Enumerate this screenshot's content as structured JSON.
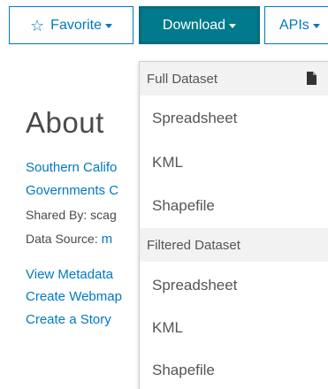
{
  "toolbar": {
    "favorite_label": "Favorite",
    "download_label": "Download",
    "apis_label": "APIs"
  },
  "about": {
    "title": "About",
    "org_line1": "Southern Califo",
    "org_line2": "Governments C",
    "shared_by": "Shared By: scag",
    "data_source_prefix": "Data Source: ",
    "data_source_link": "m",
    "links": [
      "View Metadata",
      "Create Webmap",
      "Create a Story"
    ]
  },
  "download_menu": {
    "full_header": "Full Dataset",
    "full_items": [
      "Spreadsheet",
      "KML",
      "Shapefile"
    ],
    "filtered_header": "Filtered Dataset",
    "filtered_items": [
      "Spreadsheet",
      "KML",
      "Shapefile"
    ]
  },
  "icons": {
    "favorite": "star-outline-icon",
    "caret": "caret-down-icon",
    "file": "file-icon"
  },
  "colors": {
    "link": "#0079c1",
    "download_button": "#007a8c",
    "menu_header_bg": "#f2f2f2"
  }
}
